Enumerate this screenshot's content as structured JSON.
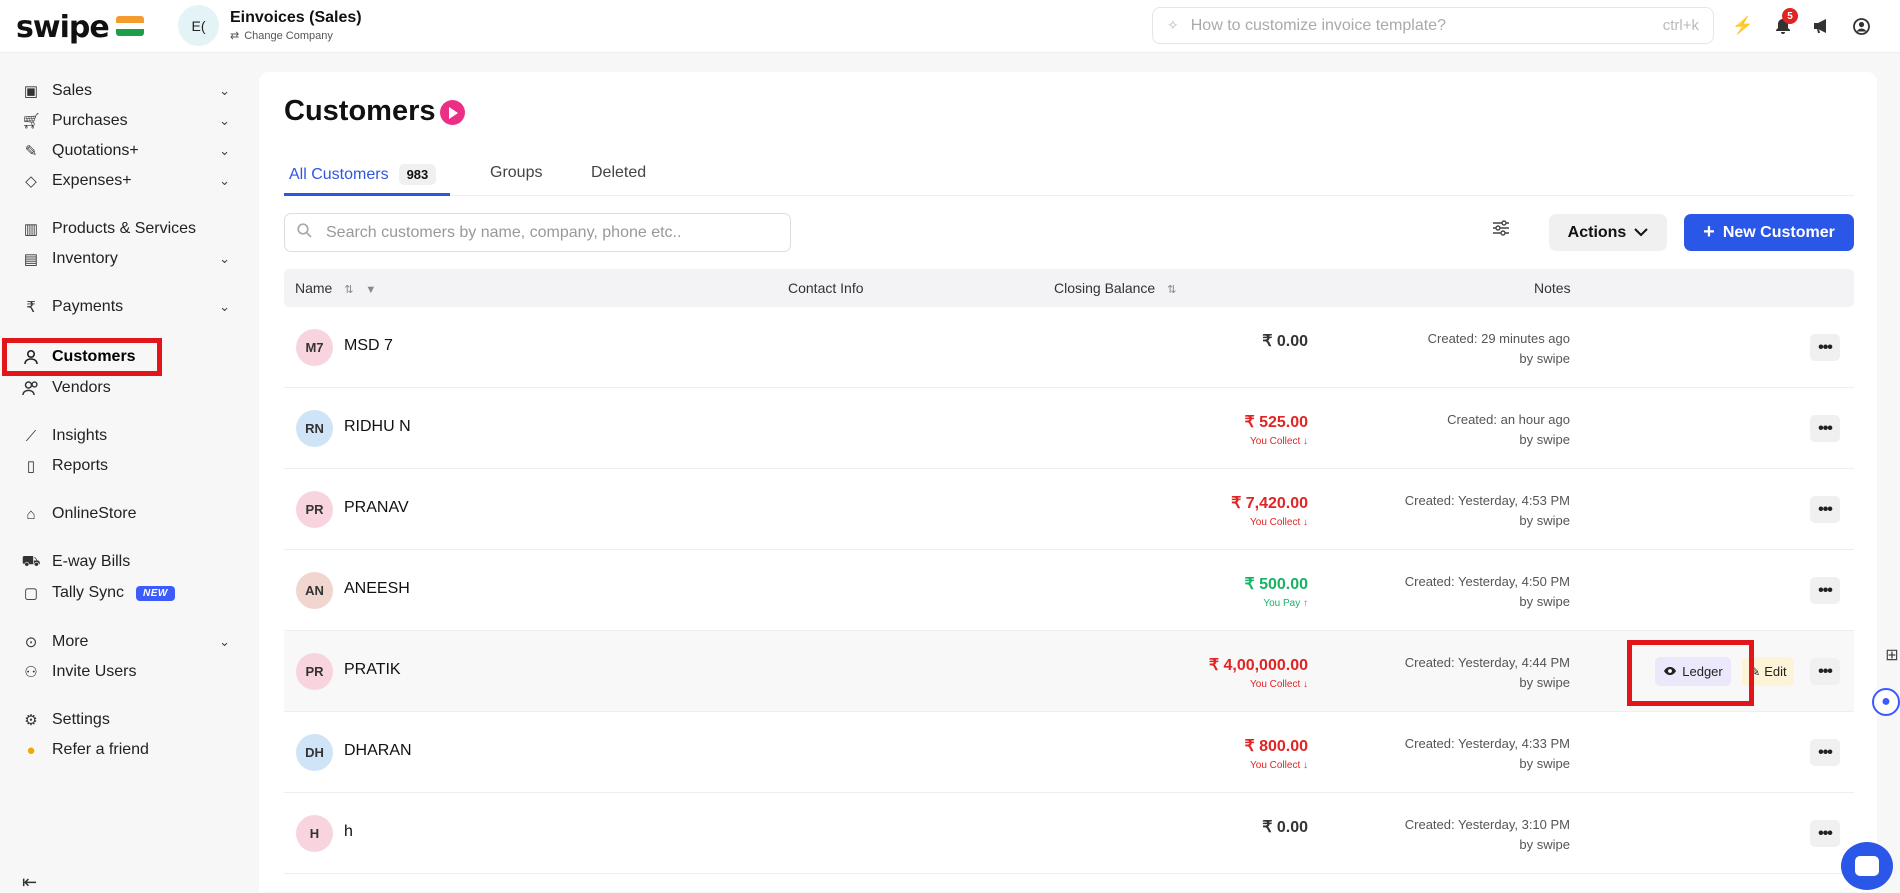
{
  "brand": {
    "logo_text": "swipe"
  },
  "company": {
    "avatar": "E(",
    "name": "Einvoices (Sales)",
    "change_label": "Change Company"
  },
  "topbar": {
    "search_placeholder": "How to customize invoice template?",
    "shortcut": "ctrl+k",
    "notification_count": "5"
  },
  "sidebar": {
    "items": [
      {
        "label": "Sales"
      },
      {
        "label": "Purchases"
      },
      {
        "label": "Quotations+"
      },
      {
        "label": "Expenses+"
      },
      {
        "label": "Products & Services"
      },
      {
        "label": "Inventory"
      },
      {
        "label": "Payments"
      },
      {
        "label": "Customers"
      },
      {
        "label": "Vendors"
      },
      {
        "label": "Insights"
      },
      {
        "label": "Reports"
      },
      {
        "label": "OnlineStore"
      },
      {
        "label": "E-way Bills"
      },
      {
        "label": "Tally Sync",
        "badge": "NEW"
      },
      {
        "label": "More"
      },
      {
        "label": "Invite Users"
      },
      {
        "label": "Settings"
      },
      {
        "label": "Refer a friend"
      }
    ]
  },
  "page": {
    "title": "Customers",
    "tabs": [
      {
        "label": "All Customers",
        "count": "983"
      },
      {
        "label": "Groups"
      },
      {
        "label": "Deleted"
      }
    ],
    "search_placeholder": "Search customers by name, company, phone etc..",
    "actions_label": "Actions",
    "new_button_label": "New Customer"
  },
  "table": {
    "columns": {
      "name": "Name",
      "contact": "Contact Info",
      "balance": "Closing Balance",
      "notes": "Notes"
    },
    "rows": [
      {
        "initials": "M7",
        "name": "MSD 7",
        "amount": "₹ 0.00",
        "status": "",
        "note1": "Created: 29 minutes ago",
        "note2": "by swipe"
      },
      {
        "initials": "RN",
        "name": "RIDHU N",
        "amount": "₹ 525.00",
        "status": "You Collect ↓",
        "note1": "Created: an hour ago",
        "note2": "by swipe"
      },
      {
        "initials": "PR",
        "name": "PRANAV",
        "amount": "₹ 7,420.00",
        "status": "You Collect ↓",
        "note1": "Created: Yesterday, 4:53 PM",
        "note2": "by swipe"
      },
      {
        "initials": "AN",
        "name": "ANEESH",
        "amount": "₹ 500.00",
        "status": "You Pay ↑",
        "note1": "Created: Yesterday, 4:50 PM",
        "note2": "by swipe"
      },
      {
        "initials": "PR",
        "name": "PRATIK",
        "amount": "₹ 4,00,000.00",
        "status": "You Collect ↓",
        "note1": "Created: Yesterday, 4:44 PM",
        "note2": "by swipe"
      },
      {
        "initials": "DH",
        "name": "DHARAN",
        "amount": "₹ 800.00",
        "status": "You Collect ↓",
        "note1": "Created: Yesterday, 4:33 PM",
        "note2": "by swipe"
      },
      {
        "initials": "H",
        "name": "h",
        "amount": "₹ 0.00",
        "status": "",
        "note1": "Created: Yesterday, 3:10 PM",
        "note2": "by swipe"
      }
    ],
    "row_actions": {
      "ledger": "Ledger",
      "edit": "Edit",
      "more": "•••"
    }
  },
  "colors": {
    "accent": "#2b57e8",
    "collect": "#e02424",
    "pay": "#16b364",
    "zero": "#333333",
    "highlight": "#e0161b"
  }
}
